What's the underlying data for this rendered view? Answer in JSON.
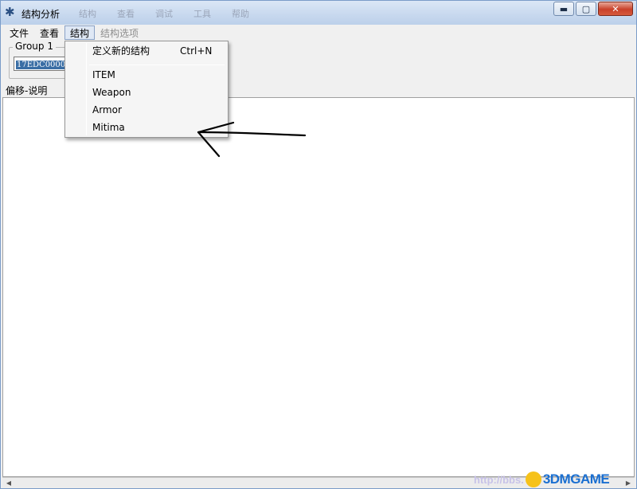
{
  "window": {
    "title": "结构分析",
    "controls": {
      "minimize": "▬",
      "maximize": "▢",
      "close": "✕"
    }
  },
  "background_strip": [
    "结构",
    "查看",
    "调试",
    "工具",
    "帮助"
  ],
  "menubar": {
    "items": [
      {
        "label": "文件",
        "state": "normal"
      },
      {
        "label": "查看",
        "state": "normal"
      },
      {
        "label": "结构",
        "state": "active"
      },
      {
        "label": "结构选项",
        "state": "disabled"
      }
    ]
  },
  "group": {
    "label": "Group 1",
    "address": "17EDC0000"
  },
  "column_header": "偏移-说明",
  "dropdown": {
    "define_new": {
      "label": "定义新的结构",
      "shortcut": "Ctrl+N"
    },
    "structures": [
      "ITEM",
      "Weapon",
      "Armor",
      "Mitima"
    ]
  },
  "watermark": {
    "url": "http://bbs.",
    "brand": "3DMGAME"
  },
  "colors": {
    "selection": "#3a6ea5",
    "title_gradient_top": "#dbe7f6",
    "close_button": "#c9412a",
    "watermark_blue": "#1a6fd1"
  }
}
